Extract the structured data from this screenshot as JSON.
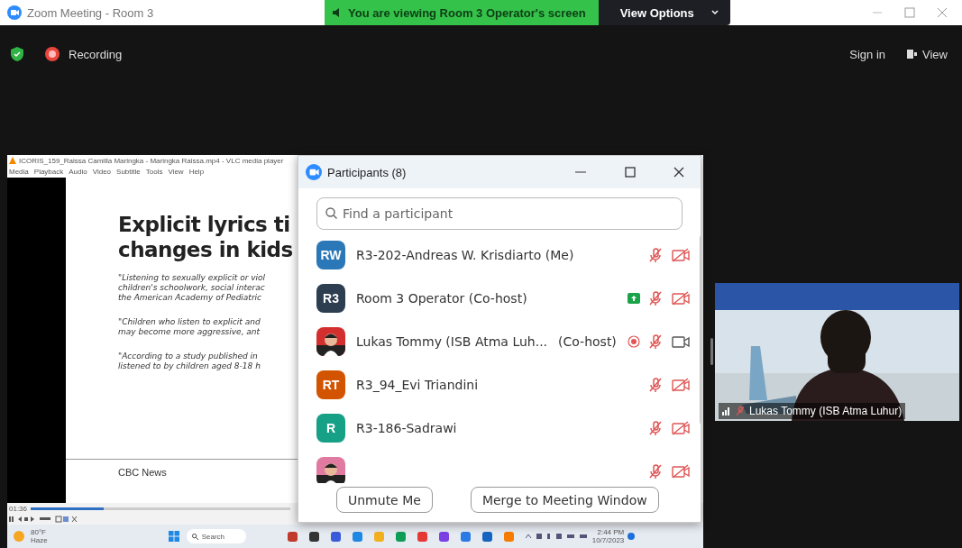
{
  "window": {
    "title": "Zoom Meeting - Room 3"
  },
  "banner": {
    "text": "You are viewing Room 3 Operator's screen",
    "button": "View Options"
  },
  "toolbar": {
    "recording": "Recording",
    "sign_in": "Sign in",
    "view": "View"
  },
  "shared_screen": {
    "player_title": "ICORIS_159_Raissa Camilla Maringka - Maringka Raissa.mp4 - VLC media player",
    "menu": [
      "Media",
      "Playback",
      "Audio",
      "Video",
      "Subtitle",
      "Tools",
      "View",
      "Help"
    ],
    "slide": {
      "title_lines": [
        "Explicit lyrics ti",
        "changes in kids"
      ],
      "quotes": [
        [
          "\"Listening to sexually explicit or viol",
          "children's schoolwork, social interac",
          "the American Academy of Pediatric"
        ],
        [
          "\"Children who listen to explicit and",
          "may become more aggressive, ant"
        ],
        [
          "\"According to a study published in",
          "listened to by children aged 8-18 h"
        ]
      ],
      "source": "CBC News"
    },
    "time": "01:36",
    "seek": {
      "level": 0.28
    },
    "taskbar": {
      "temperature": "80°F",
      "weather": "Haze",
      "search": "Search",
      "time": "2:44 PM",
      "date": "10/7/2023",
      "apps": [
        {
          "color": "#c0392b"
        },
        {
          "color": "#333333"
        },
        {
          "color": "#3b5bdb"
        },
        {
          "color": "#1e88e5"
        },
        {
          "color": "#f2b01e"
        },
        {
          "color": "#0f9d58"
        },
        {
          "color": "#e53935"
        },
        {
          "color": "#7b3fe4"
        },
        {
          "color": "#2c7be5"
        },
        {
          "color": "#1565c0"
        },
        {
          "color": "#f57c00"
        }
      ]
    }
  },
  "participants": {
    "title": "Participants (8)",
    "search": {
      "placeholder": "Find a participant"
    },
    "rows": [
      {
        "avatar": {
          "kind": "initials",
          "text": "RW",
          "color": "#2b78b8"
        },
        "name": "R3-202-Andreas W. Krisdiarto (Me)",
        "sharing": false,
        "recording": false,
        "mic_muted": true,
        "video_on": false
      },
      {
        "avatar": {
          "kind": "initials",
          "text": "R3",
          "color": "#2d3e50"
        },
        "name": "Room 3 Operator (Co-host)",
        "sharing": true,
        "recording": false,
        "mic_muted": true,
        "video_on": false
      },
      {
        "name": "Lukas Tommy (ISB Atma Luh...",
        "role": "(Co-host)",
        "sharing": false,
        "recording": true,
        "mic_muted": true,
        "video_on": true
      },
      {
        "avatar": {
          "kind": "initials",
          "text": "RT",
          "color": "#d35400"
        },
        "name": "R3_94_Evi Triandini",
        "sharing": false,
        "recording": false,
        "mic_muted": true,
        "video_on": false
      },
      {
        "avatar": {
          "kind": "initials",
          "text": "R",
          "color": "#16a085"
        },
        "name": "R3-186-Sadrawi",
        "sharing": false,
        "recording": false,
        "mic_muted": true,
        "video_on": false
      },
      {
        "sharing": false,
        "recording": false,
        "mic_muted": true,
        "video_on": false
      }
    ],
    "buttons": [
      "Unmute Me",
      "Merge to Meeting Window"
    ]
  },
  "video_tile": {
    "kind": "picture",
    "name": "Lukas Tommy (ISB Atma Luhur)",
    "mic_muted": true
  }
}
